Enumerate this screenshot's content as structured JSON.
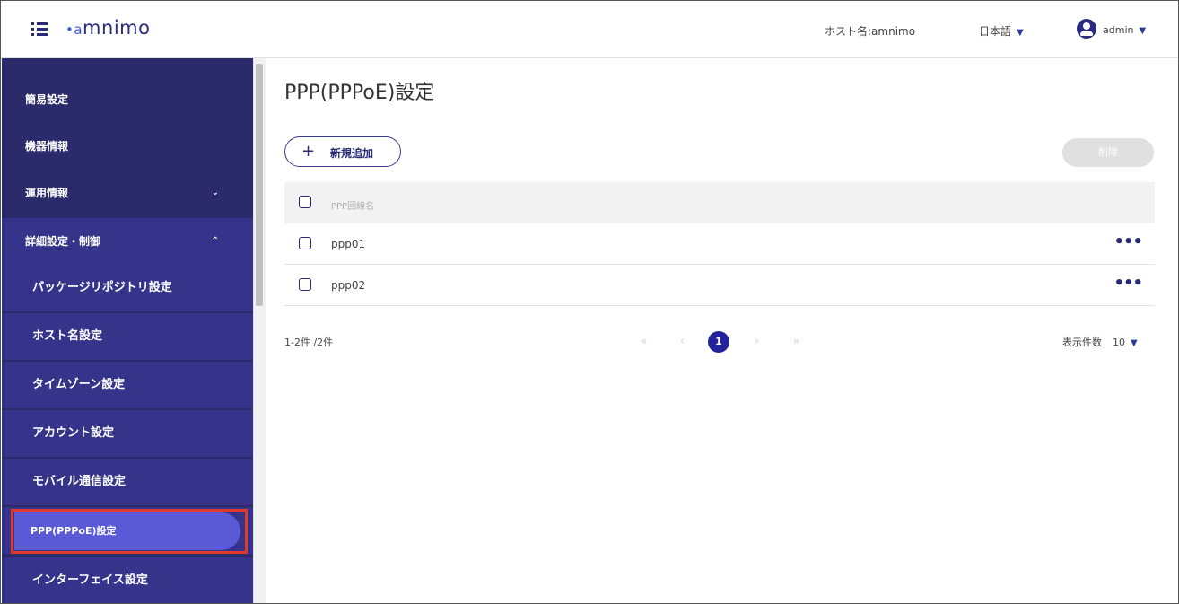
{
  "header": {
    "logo_mark": "•a",
    "logo_text": "mnimo",
    "host_label": "ホスト名:amnimo",
    "language": "日本語",
    "user": "admin",
    "caret": "▼"
  },
  "sidebar": {
    "items": [
      {
        "label": "簡易設定"
      },
      {
        "label": "機器情報"
      },
      {
        "label": "運用情報",
        "chevron": "⌄"
      },
      {
        "label": "詳細設定・制御",
        "chevron": "⌃"
      }
    ],
    "sub_items": [
      {
        "label": "パッケージリポジトリ設定"
      },
      {
        "label": "ホスト名設定"
      },
      {
        "label": "タイムゾーン設定"
      },
      {
        "label": "アカウント設定"
      },
      {
        "label": "モバイル通信設定"
      },
      {
        "label": "PPP(PPPoE)設定",
        "active": true
      },
      {
        "label": "インターフェイス設定"
      }
    ]
  },
  "main": {
    "title": "PPP(PPPoE)設定",
    "add_button": {
      "icon": "+",
      "label": "新規追加"
    },
    "delete_button": {
      "label": "削除"
    },
    "table": {
      "header": "PPP回線名",
      "rows": [
        {
          "name": "ppp01",
          "menu": "•••"
        },
        {
          "name": "ppp02",
          "menu": "•••"
        }
      ]
    },
    "range_text": "1-2件 /2件",
    "pagination": {
      "first": "«",
      "prev": "‹",
      "current": "1",
      "next": "›",
      "last": "»"
    },
    "per_page": {
      "label": "表示件数",
      "value": "10",
      "caret": "▼"
    }
  }
}
